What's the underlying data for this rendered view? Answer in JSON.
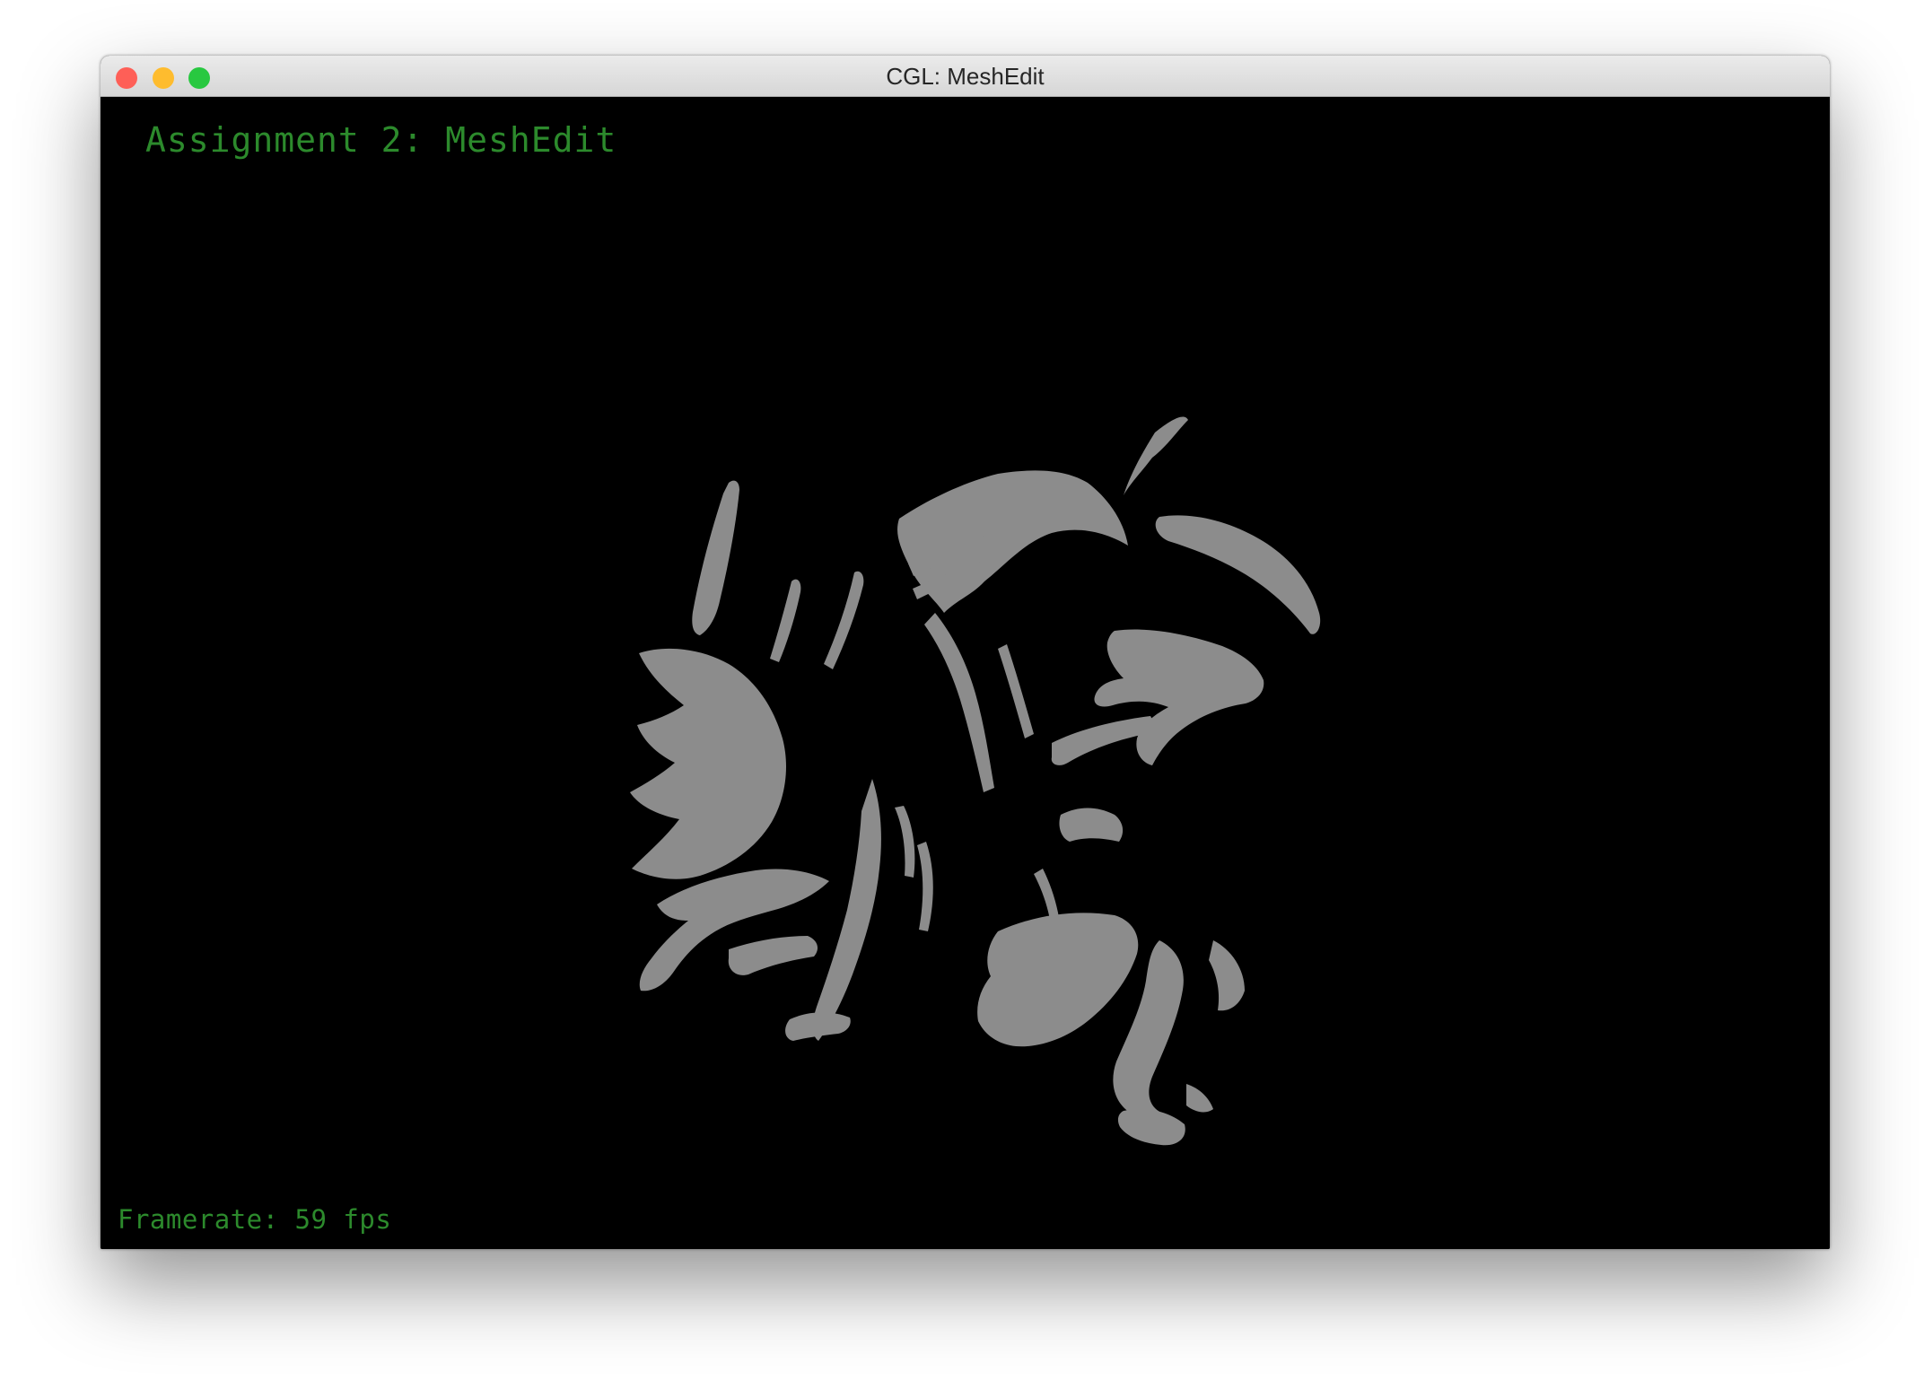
{
  "window": {
    "title": "CGL: MeshEdit",
    "traffic_lights": {
      "close_color": "#fe5f57",
      "minimize_color": "#febc2e",
      "zoom_color": "#28c840"
    }
  },
  "viewport": {
    "background_color": "#000000",
    "title": "Assignment 2: MeshEdit",
    "framerate_label": "Framerate: 59 fps",
    "text_color": "#2c8a2c",
    "mesh_color": "#8c8c8c"
  }
}
